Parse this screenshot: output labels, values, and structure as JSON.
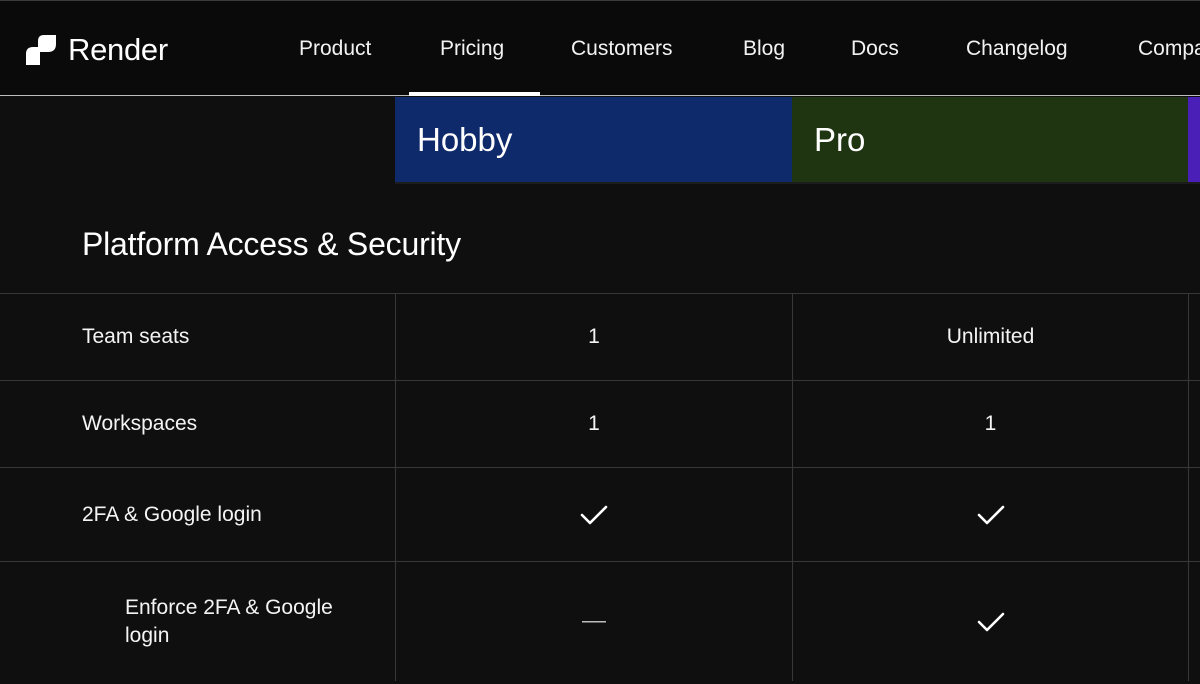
{
  "brand": {
    "name": "Render",
    "logo_icon": "render-logo-icon"
  },
  "nav": {
    "items": [
      {
        "label": "Product"
      },
      {
        "label": "Pricing",
        "active": true
      },
      {
        "label": "Customers"
      },
      {
        "label": "Blog"
      },
      {
        "label": "Docs"
      },
      {
        "label": "Changelog"
      },
      {
        "label": "Compa"
      }
    ]
  },
  "plans": [
    {
      "name": "Hobby",
      "color": "#0f2a6b"
    },
    {
      "name": "Pro",
      "color": "#1f3410"
    },
    {
      "name": "",
      "color": "#4a1fb8"
    }
  ],
  "section": {
    "title": "Platform Access & Security",
    "rows": [
      {
        "feature": "Team seats",
        "hobby": "1",
        "pro": "Unlimited"
      },
      {
        "feature": "Workspaces",
        "hobby": "1",
        "pro": "1"
      },
      {
        "feature": "2FA & Google login",
        "hobby": "check-icon",
        "pro": "check-icon"
      },
      {
        "feature": "Enforce 2FA & Google login",
        "hobby": "dash-icon",
        "pro": "check-icon"
      }
    ]
  },
  "colors": {
    "background": "#0f0f0f",
    "nav_background": "#0a0a0a",
    "divider": "#383838",
    "text": "#ffffff"
  }
}
